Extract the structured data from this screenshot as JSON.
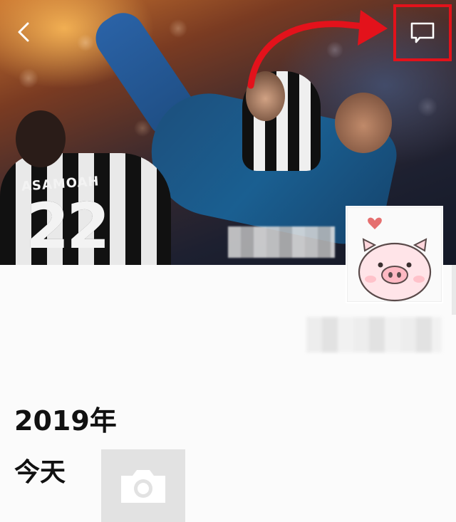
{
  "header": {
    "back_icon": "chevron-left-icon",
    "comment_icon": "speech-bubble-icon",
    "annotation_color": "#e3121b"
  },
  "cover": {
    "jersey_name": "ASAMOAH",
    "jersey_number": "22"
  },
  "profile": {
    "avatar_icon": "pig-avatar-icon"
  },
  "timeline": {
    "year": "2019年",
    "today": "今天",
    "camera_icon": "camera-icon"
  }
}
